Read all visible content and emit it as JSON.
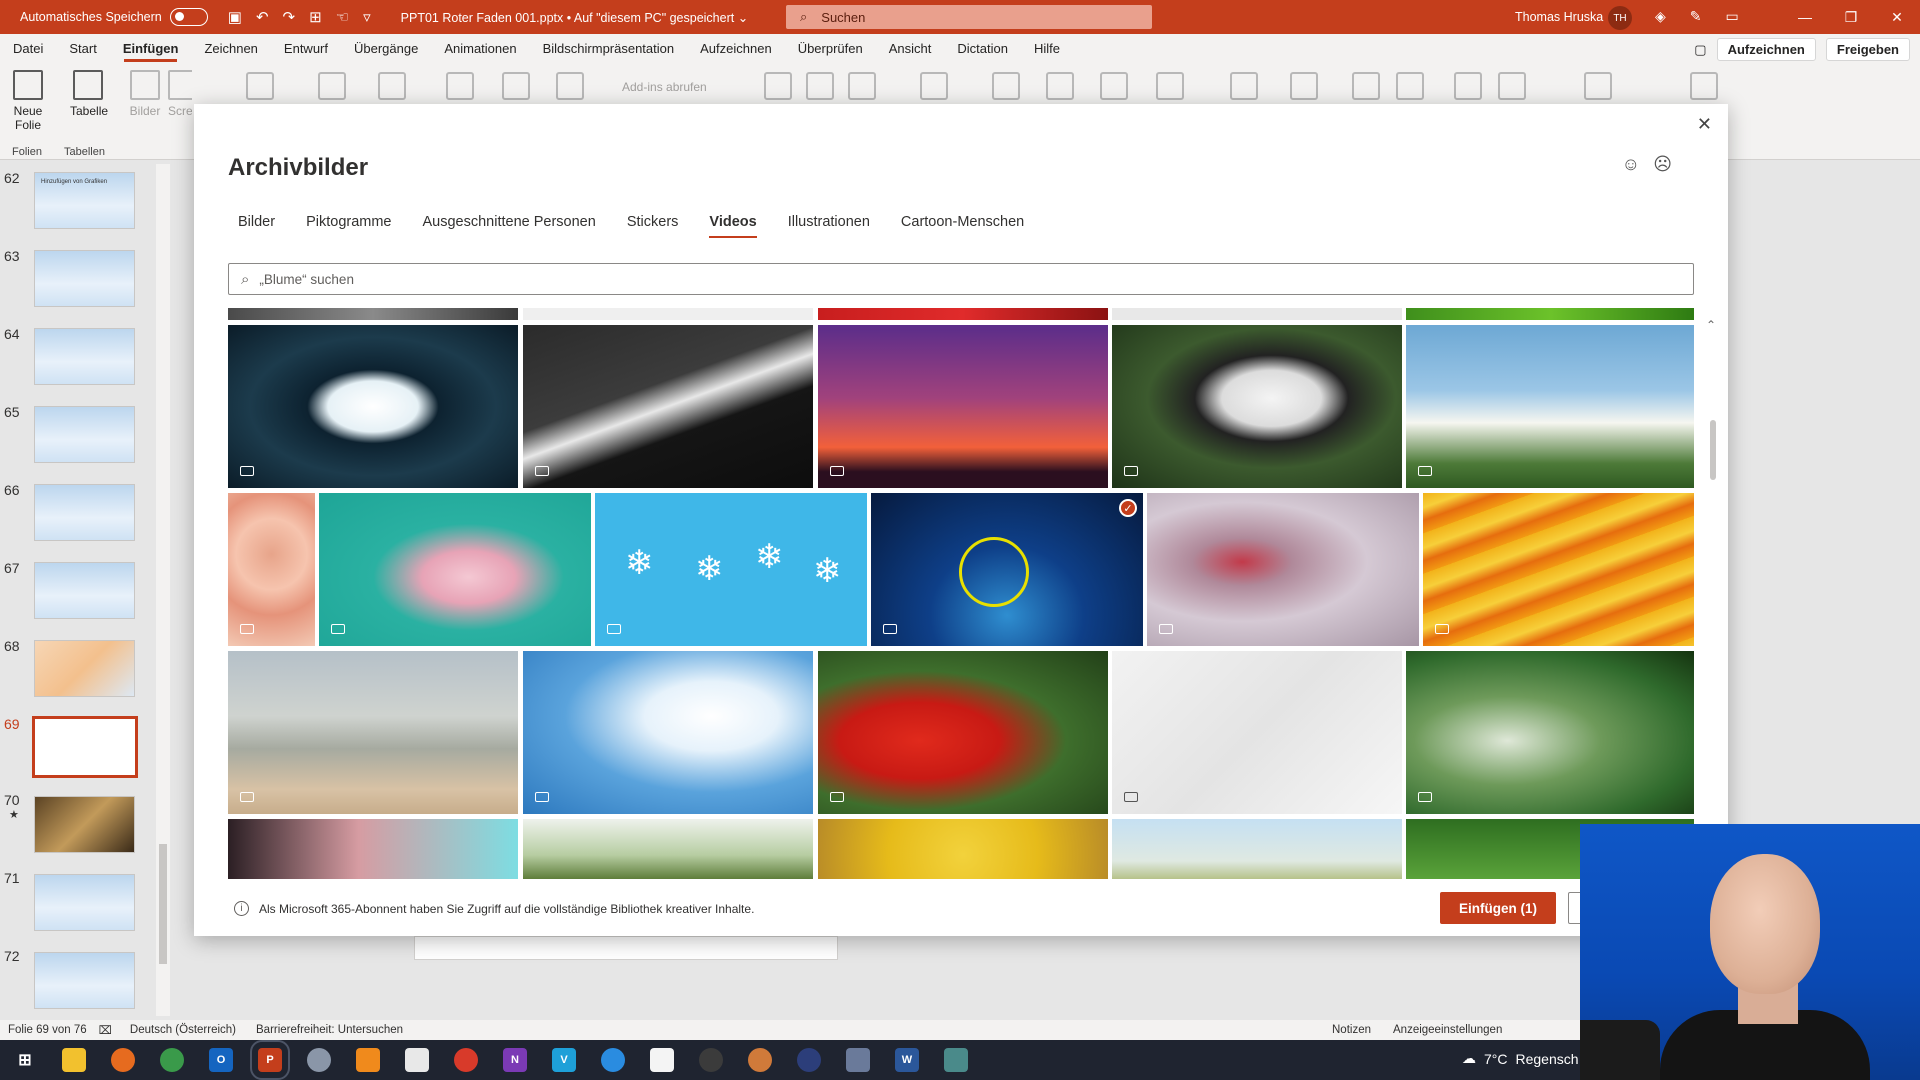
{
  "titlebar": {
    "autosave_label": "Automatisches Speichern",
    "document": "PPT01 Roter Faden 001.pptx  •  Auf \"diesem PC\" gespeichert  ⌄",
    "search_placeholder": "Suchen",
    "user_name": "Thomas Hruska",
    "user_initials": "TH"
  },
  "menu": {
    "items": [
      "Datei",
      "Start",
      "Einfügen",
      "Zeichnen",
      "Entwurf",
      "Übergänge",
      "Animationen",
      "Bildschirmpräsentation",
      "Aufzeichnen",
      "Überprüfen",
      "Ansicht",
      "Dictation",
      "Hilfe"
    ],
    "active": "Einfügen",
    "record_label": "Aufzeichnen",
    "share_label": "Freigeben"
  },
  "ribbon": {
    "new_slide": "Neue Folie",
    "table": "Tabelle",
    "images": "Bilder",
    "screenshot_trunc": "Scre",
    "addins": "Add-ins abrufen",
    "group_slides": "Folien",
    "group_tables": "Tabellen"
  },
  "slides": {
    "numbers": [
      "62",
      "63",
      "64",
      "65",
      "66",
      "67",
      "68",
      "69",
      "70",
      "71",
      "72"
    ],
    "selected": "69",
    "slide62_title": "Hinzufügen von Grafiken",
    "star_marker": "★"
  },
  "dialog": {
    "title": "Archivbilder",
    "tabs": [
      "Bilder",
      "Piktogramme",
      "Ausgeschnittene Personen",
      "Stickers",
      "Videos",
      "Illustrationen",
      "Cartoon-Menschen"
    ],
    "active_tab": "Videos",
    "search_placeholder": "„Blume“ suchen",
    "info_text": "Als Microsoft 365-Abonnent haben Sie Zugriff auf die vollständige Bibliothek kreativer Inhalte.",
    "insert_button": "Einfügen (1)",
    "selected_tile": "blue-particles"
  },
  "statusbar": {
    "slide_info": "Folie 69 von 76",
    "language": "Deutsch (Österreich)",
    "accessibility": "Barrierefreiheit: Untersuchen",
    "notes": "Notizen",
    "display_settings": "Anzeigeeinstellungen"
  },
  "taskbar": {
    "temperature": "7°C",
    "weather": "Regensch"
  },
  "colors": {
    "accent": "#c43e1c",
    "titlebar": "#c43e1c",
    "taskbar": "#1f2430"
  }
}
